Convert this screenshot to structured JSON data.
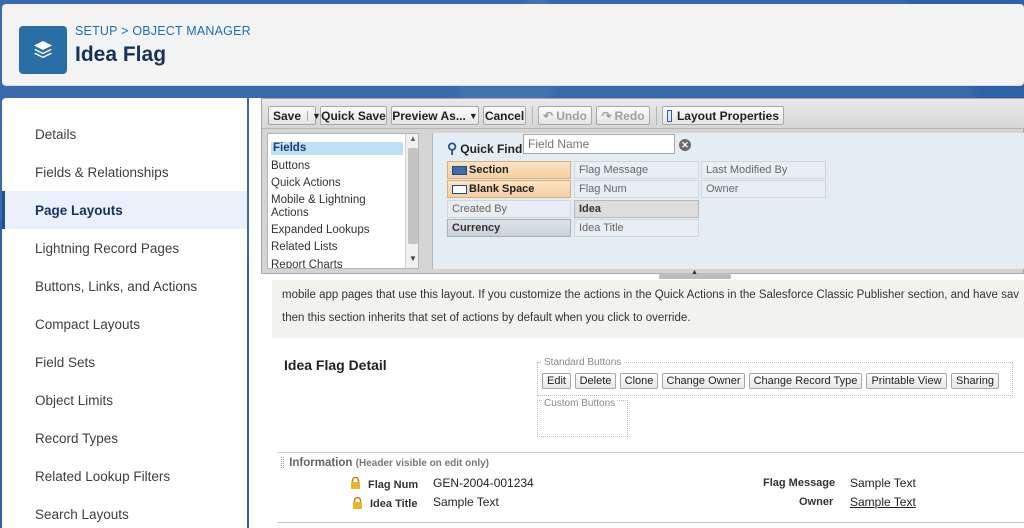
{
  "header": {
    "breadcrumb_setup": "SETUP",
    "breadcrumb_sep": " > ",
    "breadcrumb_object_manager": "OBJECT MANAGER",
    "title": "Idea Flag",
    "icon": "layers-icon"
  },
  "sidebar": {
    "items": [
      {
        "label": "Details"
      },
      {
        "label": "Fields & Relationships"
      },
      {
        "label": "Page Layouts",
        "active": true
      },
      {
        "label": "Lightning Record Pages"
      },
      {
        "label": "Buttons, Links, and Actions"
      },
      {
        "label": "Compact Layouts"
      },
      {
        "label": "Field Sets"
      },
      {
        "label": "Object Limits"
      },
      {
        "label": "Record Types"
      },
      {
        "label": "Related Lookup Filters"
      },
      {
        "label": "Search Layouts"
      }
    ]
  },
  "toolbar": {
    "save": "Save",
    "quick_save": "Quick Save",
    "preview_as": "Preview As...",
    "cancel": "Cancel",
    "undo": "Undo",
    "redo": "Redo",
    "layout_properties": "Layout Properties"
  },
  "palette": {
    "categories": [
      {
        "label": "Fields",
        "selected": true
      },
      {
        "label": "Buttons"
      },
      {
        "label": "Quick Actions"
      },
      {
        "label": "Mobile & Lightning Actions"
      },
      {
        "label": "Expanded Lookups"
      },
      {
        "label": "Related Lists"
      },
      {
        "label": "Report Charts"
      }
    ],
    "quick_find_label": "Quick Find",
    "quick_find_placeholder": "Field Name",
    "fields": {
      "section": "Section",
      "blank_space": "Blank Space",
      "created_by": "Created By",
      "currency": "Currency",
      "flag_message": "Flag Message",
      "flag_num": "Flag Num",
      "idea": "Idea",
      "idea_title": "Idea Title",
      "last_modified_by": "Last Modified By",
      "owner": "Owner"
    }
  },
  "layout": {
    "info_line1": "mobile app pages that use this layout. If you customize the actions in the Quick Actions in the Salesforce Classic Publisher section, and have sav",
    "info_line2": "then this section inherits that set of actions by default when you click to override.",
    "detail_title": "Idea Flag Detail",
    "standard_buttons_label": "Standard Buttons",
    "standard_buttons": [
      "Edit",
      "Delete",
      "Clone",
      "Change Owner",
      "Change Record Type",
      "Printable View",
      "Sharing"
    ],
    "custom_buttons_label": "Custom Buttons",
    "information_label": "Information",
    "information_sub": "(Header visible on edit only)",
    "rows": {
      "flag_num_label": "Flag Num",
      "flag_num_value": "GEN-2004-001234",
      "idea_title_label": "Idea Title",
      "idea_title_value": "Sample Text",
      "flag_message_label": "Flag Message",
      "flag_message_value": "Sample Text",
      "owner_label": "Owner",
      "owner_value": "Sample Text"
    }
  },
  "colors": {
    "brand_blue": "#2a6ea6",
    "sidebar_active": "#ebf1fa",
    "chip_orange": "#f4cfa3"
  }
}
